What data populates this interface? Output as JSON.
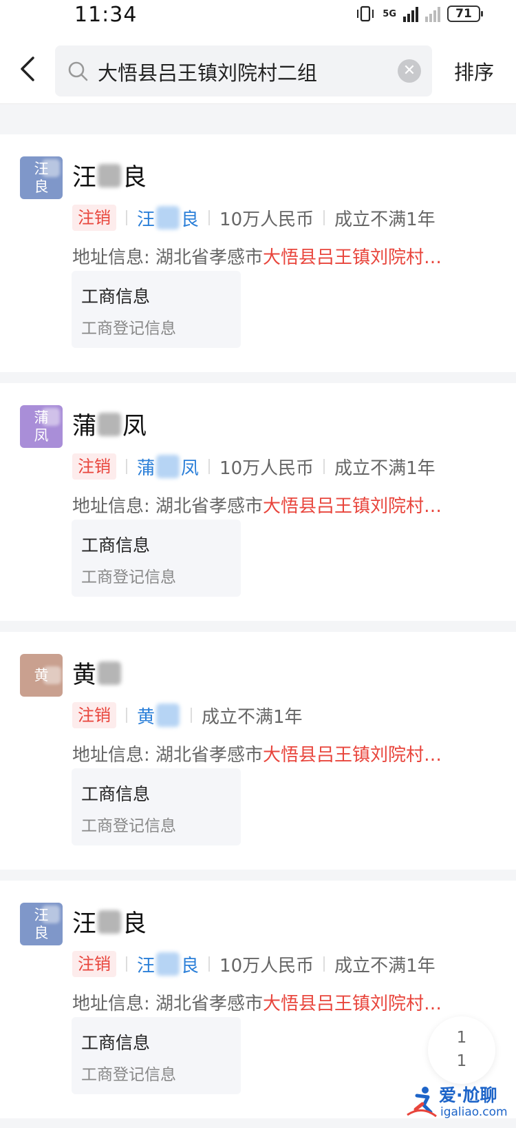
{
  "status_bar": {
    "time": "11:34",
    "network": "5G",
    "battery": "71"
  },
  "header": {
    "search_value": "大悟县吕王镇刘院村二组",
    "sort_label": "排序"
  },
  "results": [
    {
      "avatar": [
        "汪",
        "良"
      ],
      "avatar_color": "#7f97c9",
      "name_first": "汪",
      "name_last": "良",
      "status": "注销",
      "legal_first": "汪",
      "legal_last": "良",
      "capital": "10万人民币",
      "age": "成立不满1年",
      "addr_label": "地址信息:",
      "addr_plain": "湖北省孝感市",
      "addr_highlight": "大悟县吕王镇刘院村…",
      "info_title": "工商信息",
      "info_sub": "工商登记信息"
    },
    {
      "avatar": [
        "蒲",
        "凤"
      ],
      "avatar_color": "#a98ed8",
      "name_first": "蒲",
      "name_last": "凤",
      "status": "注销",
      "legal_first": "蒲",
      "legal_last": "凤",
      "capital": "10万人民币",
      "age": "成立不满1年",
      "addr_label": "地址信息:",
      "addr_plain": "湖北省孝感市",
      "addr_highlight": "大悟县吕王镇刘院村…",
      "info_title": "工商信息",
      "info_sub": "工商登记信息"
    },
    {
      "avatar": [
        "黄",
        ""
      ],
      "avatar_color": "#c9a08f",
      "name_first": "黄",
      "name_last": "",
      "status": "注销",
      "legal_first": "黄",
      "legal_last": "",
      "capital": "",
      "age": "成立不满1年",
      "addr_label": "地址信息:",
      "addr_plain": "湖北省孝感市",
      "addr_highlight": "大悟县吕王镇刘院村…",
      "info_title": "工商信息",
      "info_sub": "工商登记信息"
    },
    {
      "avatar": [
        "汪",
        "良"
      ],
      "avatar_color": "#7f97c9",
      "name_first": "汪",
      "name_last": "良",
      "status": "注销",
      "legal_first": "汪",
      "legal_last": "良",
      "capital": "10万人民币",
      "age": "成立不满1年",
      "addr_label": "地址信息:",
      "addr_plain": "湖北省孝感市",
      "addr_highlight": "大悟县吕王镇刘院村…",
      "info_title": "工商信息",
      "info_sub": "工商登记信息"
    }
  ],
  "pagination": {
    "current": "1",
    "total": "1"
  },
  "watermark": {
    "title": "爱·尬聊",
    "url": "igaliao.com"
  }
}
